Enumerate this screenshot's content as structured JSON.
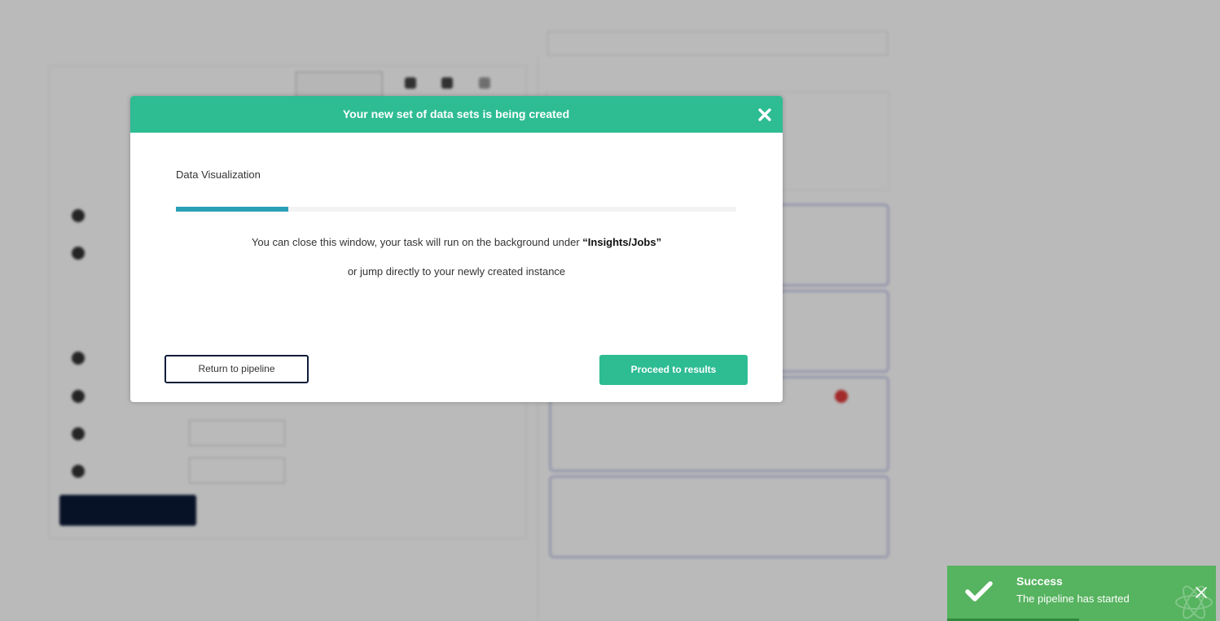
{
  "modal": {
    "title": "Your new set of data sets is being created",
    "task_name": "Data Visualization",
    "progress": 0.2,
    "message_prefix": "You can close this window, your task will run on the background under ",
    "message_location": "“Insights/Jobs”",
    "message_line2": "or jump directly to your newly created instance",
    "return_label": "Return to pipeline",
    "proceed_label": "Proceed to results",
    "close_icon": "close-icon"
  },
  "toast": {
    "title": "Success",
    "message": "The pipeline has started",
    "icon": "checkmark-icon",
    "close_icon": "close-icon",
    "timer_progress": 0.49
  },
  "colors": {
    "accent": "#2ebc93",
    "progress": "#2aa0b7",
    "success": "#56b35f",
    "dark_button": "#0e1c38"
  }
}
